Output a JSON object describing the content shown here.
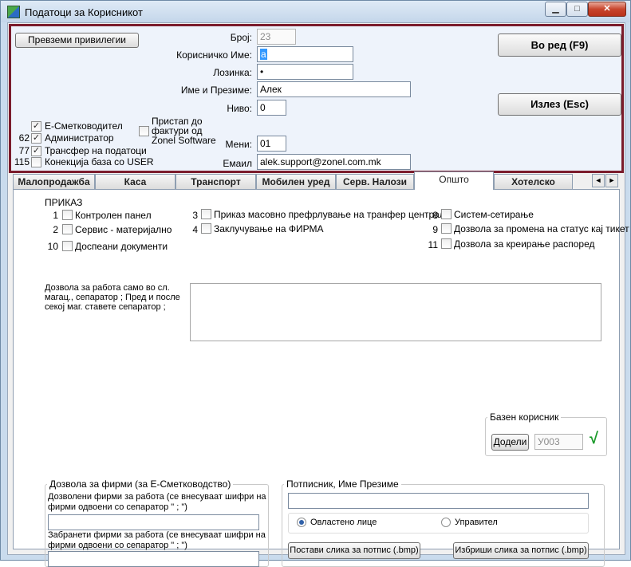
{
  "window": {
    "title": "Податоци за Корисникот",
    "min_glyph": "▁",
    "max_glyph": "□",
    "close_glyph": "✕"
  },
  "header": {
    "privileges_button": "Превземи привилегии",
    "ok_button": "Во ред (F9)",
    "exit_button": "Излез (Esc)",
    "fields": {
      "broj_label": "Број:",
      "broj_value": "23",
      "username_label": "Корисничко Име:",
      "username_value": "a",
      "password_label": "Лозинка:",
      "password_value": "•",
      "fullname_label": "Име и Презиме:",
      "fullname_value": "Алек",
      "level_label": "Ниво:",
      "level_value": "0",
      "menu_label": "Мени:",
      "menu_value": "01",
      "email_label": "Емаил",
      "email_value": "alek.support@zonel.com.mk"
    },
    "checkboxes": [
      {
        "num": "",
        "label": "Е-Сметководител",
        "checked": true
      },
      {
        "num": "62",
        "label": "Администратор",
        "checked": true
      },
      {
        "num": "77",
        "label": "Трансфер на податоци",
        "checked": true
      },
      {
        "num": "115",
        "label": "Конекција база со USER",
        "checked": false
      }
    ],
    "zonel_access": {
      "label_line1": "Пристап до",
      "label_line2": "фактури од",
      "label_line3": "Zonel Software",
      "checked": false
    }
  },
  "tabs": [
    "Малопродажба",
    "Каса",
    "Транспорт",
    "Мобилен уред",
    "Серв. Налози",
    "Општо",
    "Хотелско"
  ],
  "active_tab": "Општо",
  "scroll_left": "◄",
  "scroll_right": "►",
  "general": {
    "heading": "ПРИКАЗ",
    "col1": [
      {
        "num": "1",
        "label": "Контролен панел"
      },
      {
        "num": "2",
        "label": "Сервис - материјално"
      },
      {
        "num": "10",
        "label": "Доспеани документи"
      }
    ],
    "col2": [
      {
        "num": "3",
        "label": "Приказ масовно префрлување на транфер централа"
      },
      {
        "num": "4",
        "label": "Заклучување на ФИРМА"
      }
    ],
    "col3": [
      {
        "num": "8",
        "label": "Систем-сетирање"
      },
      {
        "num": "9",
        "label": "Дозвола за промена на статус кај тикет"
      },
      {
        "num": "11",
        "label": "Дозвола за креирање распоред"
      }
    ],
    "warehouse_note_line1": "Дозвола за работа само во сл.",
    "warehouse_note_line2": "магац., сепаратор  ; Пред и после",
    "warehouse_note_line3": "секој маг. ставете сепаратор ;",
    "base_user": {
      "title": "Базен корисник",
      "assign_button": "Додели",
      "value": "У003",
      "check_glyph": "√"
    },
    "firms": {
      "title": "Дозвола за фирми (за Е-Сметководство)",
      "allowed_line1": "Дозволени фирми за работа (се внесуваат шифри на",
      "allowed_line2": "фирми одвоени со сепаратор \" ; \")",
      "banned_line1": "Забранети фирми за работа (се внесуваат шифри на",
      "banned_line2": "фирми одвоени со сепаратор \" ; \")"
    },
    "signer": {
      "title": "Потписник, Име Презиме",
      "radio_authorized": "Овластено лице",
      "radio_manager": "Управител",
      "set_button": "Постави слика за потпис (.bmp)",
      "delete_button": "Избриши слика за потпис (.bmp)"
    }
  },
  "colors": {
    "frame_border": "#7b1c2c",
    "check_green": "#1a9a2a"
  }
}
